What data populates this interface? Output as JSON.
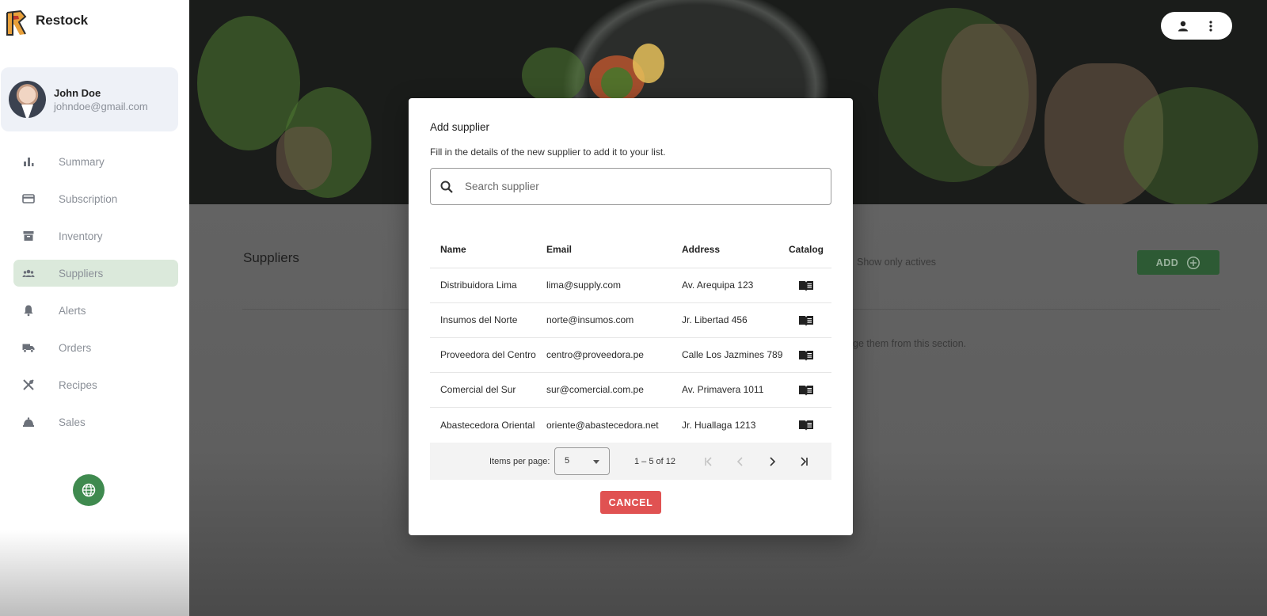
{
  "app": {
    "name": "Restock"
  },
  "user": {
    "name": "John Doe",
    "email": "johndoe@gmail.com"
  },
  "sidebar": {
    "items": [
      {
        "label": "Summary",
        "icon": "bar-chart-icon",
        "active": false
      },
      {
        "label": "Subscription",
        "icon": "credit-card-icon",
        "active": false
      },
      {
        "label": "Inventory",
        "icon": "archive-box-icon",
        "active": false
      },
      {
        "label": "Suppliers",
        "icon": "people-icon",
        "active": true
      },
      {
        "label": "Alerts",
        "icon": "bell-icon",
        "active": false
      },
      {
        "label": "Orders",
        "icon": "truck-icon",
        "active": false
      },
      {
        "label": "Recipes",
        "icon": "utensils-icon",
        "active": false
      },
      {
        "label": "Sales",
        "icon": "sales-icon",
        "active": false
      }
    ],
    "language_button_icon": "globe-icon"
  },
  "page": {
    "title": "Suppliers",
    "filter_label": "Show only actives",
    "add_label": "ADD",
    "hint_text": "ge them from this section."
  },
  "modal": {
    "title": "Add supplier",
    "subtitle": "Fill in the details of the new supplier to add it to your list.",
    "search_placeholder": "Search supplier",
    "columns": {
      "name": "Name",
      "email": "Email",
      "address": "Address",
      "catalog": "Catalog"
    },
    "rows": [
      {
        "name": "Distribuidora Lima",
        "email": "lima@supply.com",
        "address": "Av. Arequipa 123"
      },
      {
        "name": "Insumos del Norte",
        "email": "norte@insumos.com",
        "address": "Jr. Libertad 456"
      },
      {
        "name": "Proveedora del Centro",
        "email": "centro@proveedora.pe",
        "address": "Calle Los Jazmines 789"
      },
      {
        "name": "Comercial del Sur",
        "email": "sur@comercial.com.pe",
        "address": "Av. Primavera 1011"
      },
      {
        "name": "Abastecedora Oriental",
        "email": "oriente@abastecedora.net",
        "address": "Jr. Huallaga 1213"
      }
    ],
    "paginator": {
      "items_per_page_label": "Items per page:",
      "page_size": "5",
      "range_label": "1 – 5 of 12"
    },
    "cancel_label": "CANCEL"
  },
  "colors": {
    "primary_green": "#3f8a4f",
    "cancel_red": "#e05252",
    "active_nav_bg": "#dbe9db"
  }
}
